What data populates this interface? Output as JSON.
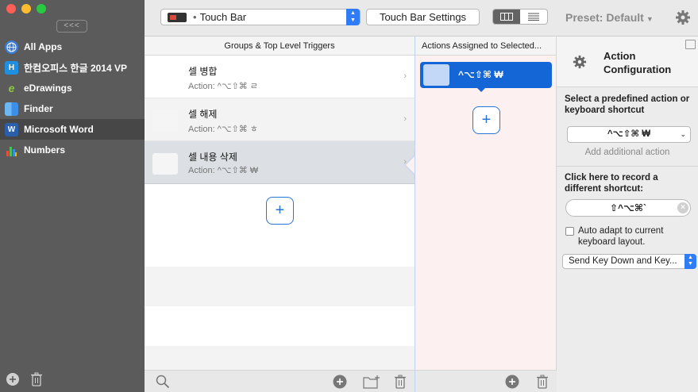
{
  "sidebar": {
    "collapse_label": "<<<",
    "apps": [
      {
        "label": "All Apps",
        "icon": "globe-icon"
      },
      {
        "label": "한컴오피스 한글 2014 VP",
        "icon": "hwp-app-icon"
      },
      {
        "label": "eDrawings",
        "icon": "edrawings-app-icon"
      },
      {
        "label": "Finder",
        "icon": "finder-app-icon"
      },
      {
        "label": "Microsoft Word",
        "icon": "word-app-icon",
        "selected": true
      },
      {
        "label": "Numbers",
        "icon": "numbers-app-icon"
      }
    ]
  },
  "toolbar": {
    "selector_label": "Touch Bar",
    "settings_label": "Touch Bar Settings",
    "preset_label": "Preset: Default"
  },
  "groups": {
    "header": "Groups & Top Level Triggers",
    "rows": [
      {
        "title": "셀 병합",
        "action": "Action: ^⌥⇧⌘ ㄹ"
      },
      {
        "title": "셀 해제",
        "action": "Action: ^⌥⇧⌘ ㅎ"
      },
      {
        "title": "셀 내용 삭제",
        "action": "Action: ^⌥⇧⌘ ₩"
      }
    ],
    "add_label": "+"
  },
  "actions": {
    "header": "Actions Assigned to Selected...",
    "item_label": "^⌥⇧⌘ ₩",
    "add_label": "+"
  },
  "config": {
    "title_line1": "Action",
    "title_line2": "Configuration",
    "predefined_label": "Select a predefined action or keyboard shortcut",
    "shortcut_value": "^⌥⇧⌘ ₩",
    "add_additional": "Add additional action",
    "record_label": "Click here to record a different shortcut:",
    "record_value": "⇧^⌥⌘`",
    "auto_adapt_label": "Auto adapt to current keyboard layout.",
    "send_mode_value": "Send Key Down and Key..."
  },
  "colors": {
    "sidebar_bg": "#5b5b5b",
    "accent": "#1466d6",
    "actions_bg": "#fdf0f0"
  }
}
